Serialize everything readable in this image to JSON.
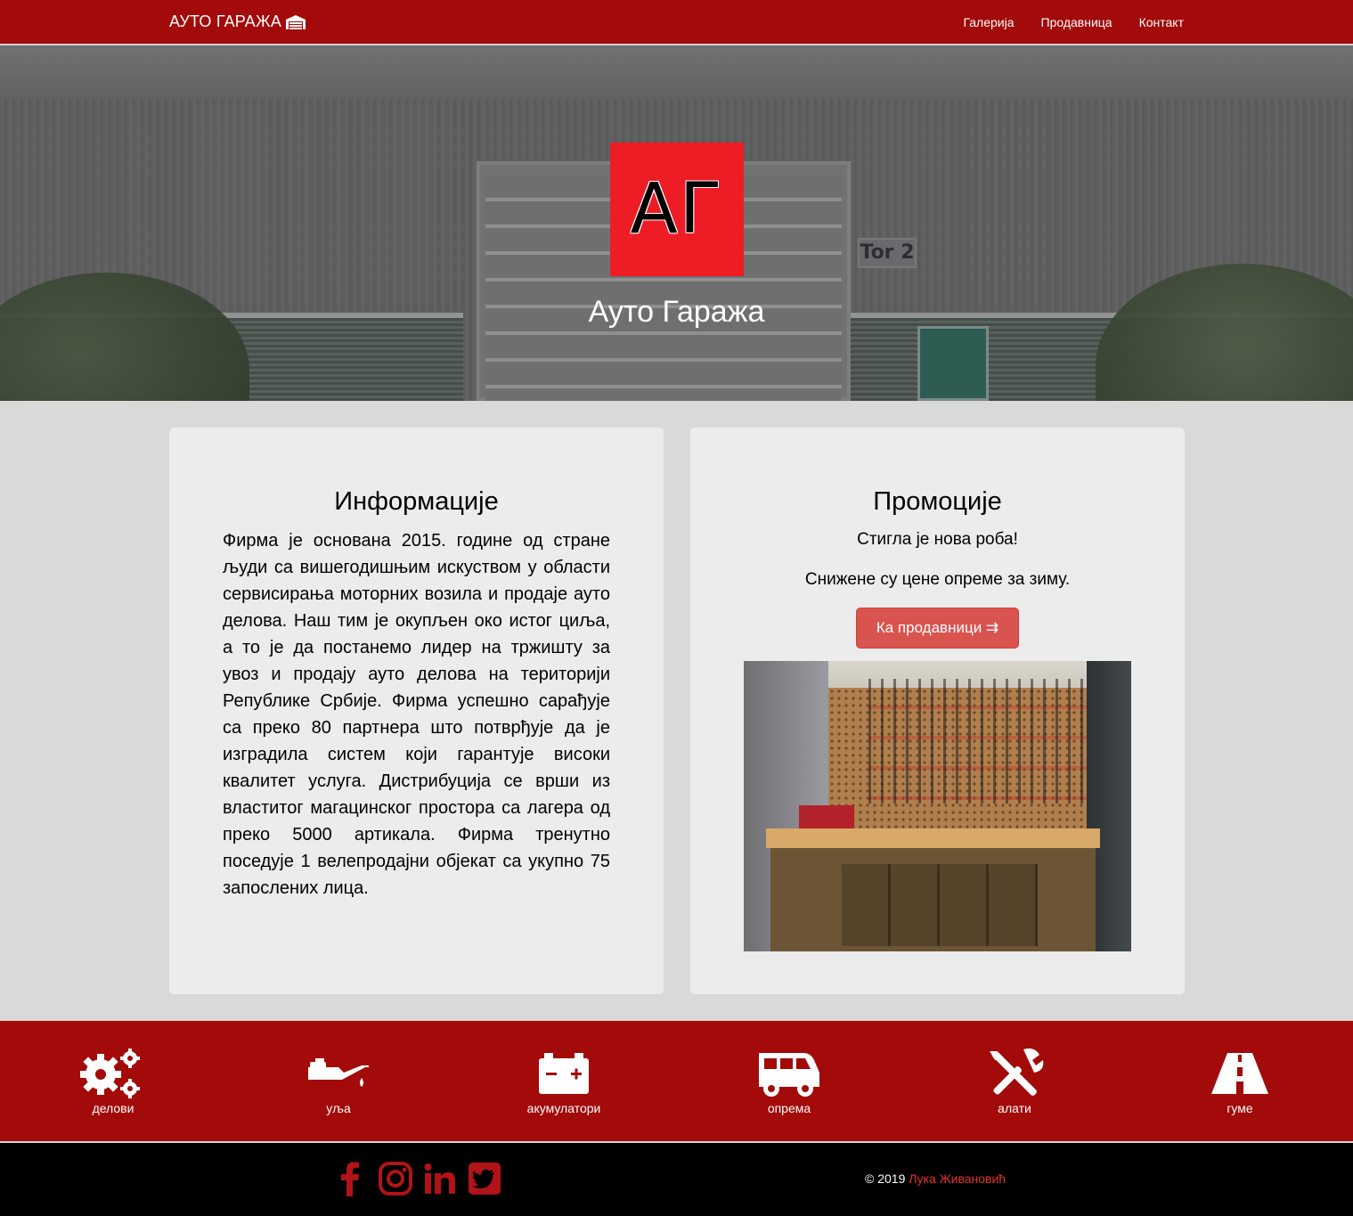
{
  "navbar": {
    "brand": "АУТО ГАРАЖА",
    "brand_icon": "garage-icon",
    "links": [
      "Галерија",
      "Продавница",
      "Контакт"
    ]
  },
  "hero": {
    "logo_text": "АГ",
    "title": "Ауто Гаража",
    "sign_text": "Tor 2"
  },
  "info": {
    "heading": "Информације",
    "text": "Фирма је основана 2015. године од стране људи са вишегодишњим искуством у области сервисирања моторних возила и продаје ауто делова. Наш тим је окупљен око истог циља, а то је да постанемо лидер на тржишту за увоз и продају ауто делова на територији Републике Србије. Фирма успешно сарађује са преко 80 партнера што потврђује да је изградила систем који гарантује високи квалитет услуга. Дистрибуција се врши из властитог магацинског простора са лагера од преко 5000 артикала. Фирма тренутно поседује 1 велепродајни објекат са укупно 75 запослених лица."
  },
  "promo": {
    "heading": "Промоције",
    "line1": "Стигла је нова роба!",
    "line2": "Снижене су цене опреме за зиму.",
    "button_label": "Ка продавници ⇉"
  },
  "categories": [
    {
      "label": "делови",
      "icon": "gears-icon"
    },
    {
      "label": "уља",
      "icon": "oil-can-icon"
    },
    {
      "label": "акумулатори",
      "icon": "battery-icon"
    },
    {
      "label": "опрема",
      "icon": "van-icon"
    },
    {
      "label": "алати",
      "icon": "tools-icon"
    },
    {
      "label": "гуме",
      "icon": "road-icon"
    }
  ],
  "footer": {
    "social": [
      "facebook-icon",
      "instagram-icon",
      "linkedin-icon",
      "twitter-icon"
    ],
    "copyright_prefix": "© 2019 ",
    "author": "Лука Живановић"
  },
  "colors": {
    "primary_red": "#a30a0a",
    "logo_red": "#ee1c25",
    "button_red": "#d9534f",
    "card_bg": "#ececec",
    "page_bg": "#d9d9d9"
  }
}
